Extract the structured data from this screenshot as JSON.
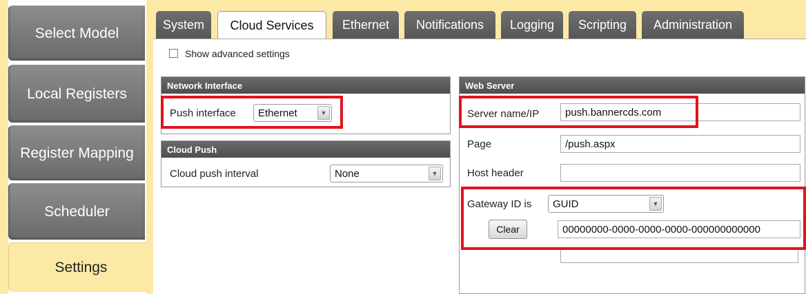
{
  "sidebar": {
    "items": [
      {
        "label": "Select Model"
      },
      {
        "label": "Local Registers"
      },
      {
        "label": "Register Mapping"
      },
      {
        "label": "Scheduler"
      },
      {
        "label": "Settings"
      }
    ],
    "active": "Settings"
  },
  "tabs": [
    {
      "label": "System"
    },
    {
      "label": "Cloud Services"
    },
    {
      "label": "Ethernet"
    },
    {
      "label": "Notifications"
    },
    {
      "label": "Logging"
    },
    {
      "label": "Scripting"
    },
    {
      "label": "Administration"
    }
  ],
  "active_tab": "Cloud Services",
  "advanced": {
    "label": "Show advanced settings",
    "checked": false
  },
  "network_interface": {
    "title": "Network Interface",
    "push_label": "Push interface",
    "push_value": "Ethernet"
  },
  "cloud_push": {
    "title": "Cloud Push",
    "interval_label": "Cloud push interval",
    "interval_value": "None"
  },
  "web_server": {
    "title": "Web Server",
    "server_label": "Server name/IP",
    "server_value": "push.bannercds.com",
    "page_label": "Page",
    "page_value": "/push.aspx",
    "host_label": "Host header",
    "host_value": "",
    "gateway_label": "Gateway ID is",
    "gateway_value": "GUID",
    "clear_label": "Clear",
    "gateway_id_value": "00000000-0000-0000-0000-000000000000"
  },
  "colors": {
    "accent_yellow": "#fde9a6",
    "nav_gray": "#7a7a7a",
    "highlight_red": "#e0141e"
  }
}
